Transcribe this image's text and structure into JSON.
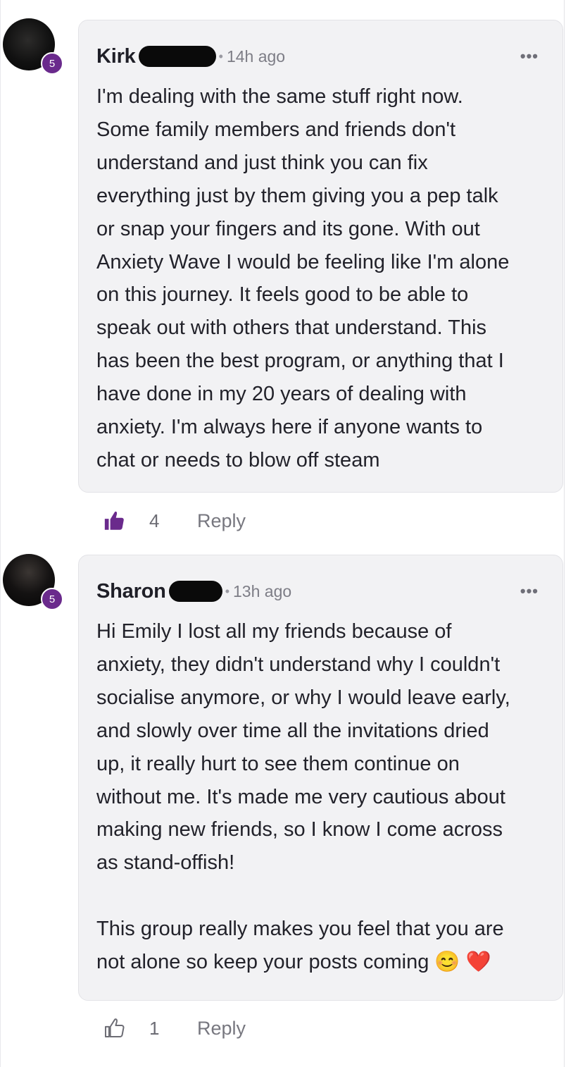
{
  "comments": [
    {
      "author": "Kirk",
      "level": "5",
      "time": "14h ago",
      "more": "•••",
      "text": "I'm dealing with the same stuff right now.\nSome family members and friends don't\nunderstand and just think you can fix\neverything just by them giving you a pep talk\nor snap your fingers and its gone. With out\nAnxiety Wave I would be feeling like I'm alone\non this journey. It feels good to be able to\nspeak out with others that understand. This\nhas been the best program, or anything that I\nhave done in my 20 years of dealing with\nanxiety. I'm always here if anyone wants to\nchat or needs to blow off steam",
      "likes": "4",
      "liked": true,
      "reply_label": "Reply"
    },
    {
      "author": "Sharon",
      "level": "5",
      "time": "13h ago",
      "more": "•••",
      "text": "Hi Emily I lost all my friends because of\nanxiety, they didn't understand why I couldn't\nsocialise anymore, or why I would leave early,\nand slowly over time all the invitations dried\nup, it really hurt to see them continue on\nwithout me. It's made me very cautious about\nmaking new friends, so I know I come across\nas stand-offish!\n\nThis group really makes you feel that you are\nnot alone so keep your posts coming 😊 ❤️",
      "likes": "1",
      "liked": false,
      "reply_label": "Reply"
    }
  ],
  "colors": {
    "accent": "#6a2a8c",
    "bubble": "#f2f2f4",
    "muted": "#7d7d86"
  }
}
